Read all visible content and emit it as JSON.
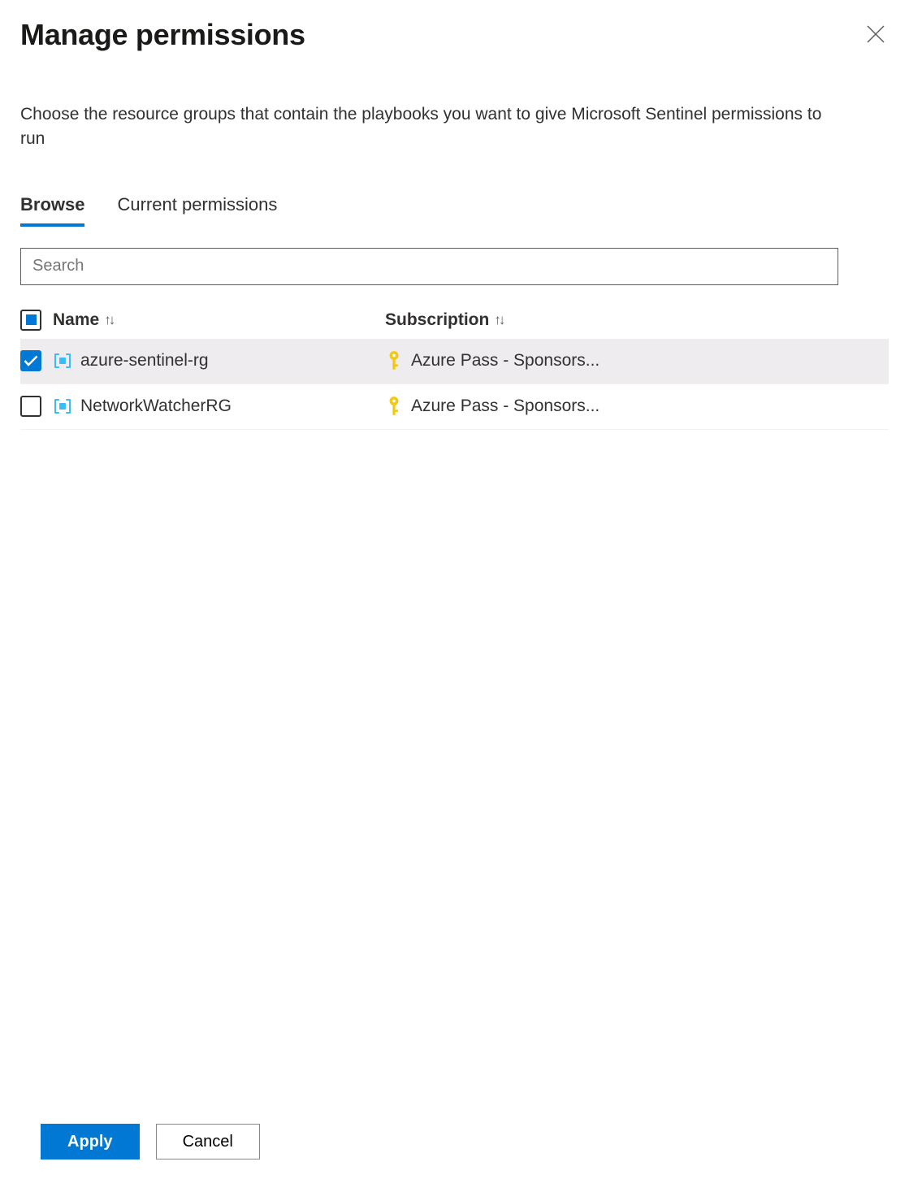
{
  "header": {
    "title": "Manage permissions"
  },
  "description": "Choose the resource groups that contain the playbooks you want to give Microsoft Sentinel permissions to run",
  "tabs": {
    "browse": "Browse",
    "current": "Current permissions"
  },
  "search": {
    "placeholder": "Search",
    "value": ""
  },
  "table": {
    "columns": {
      "name": "Name",
      "subscription": "Subscription"
    },
    "rows": [
      {
        "name": "azure-sentinel-rg",
        "subscription": "Azure Pass - Sponsors...",
        "checked": true
      },
      {
        "name": "NetworkWatcherRG",
        "subscription": "Azure Pass - Sponsors...",
        "checked": false
      }
    ]
  },
  "footer": {
    "apply": "Apply",
    "cancel": "Cancel"
  }
}
